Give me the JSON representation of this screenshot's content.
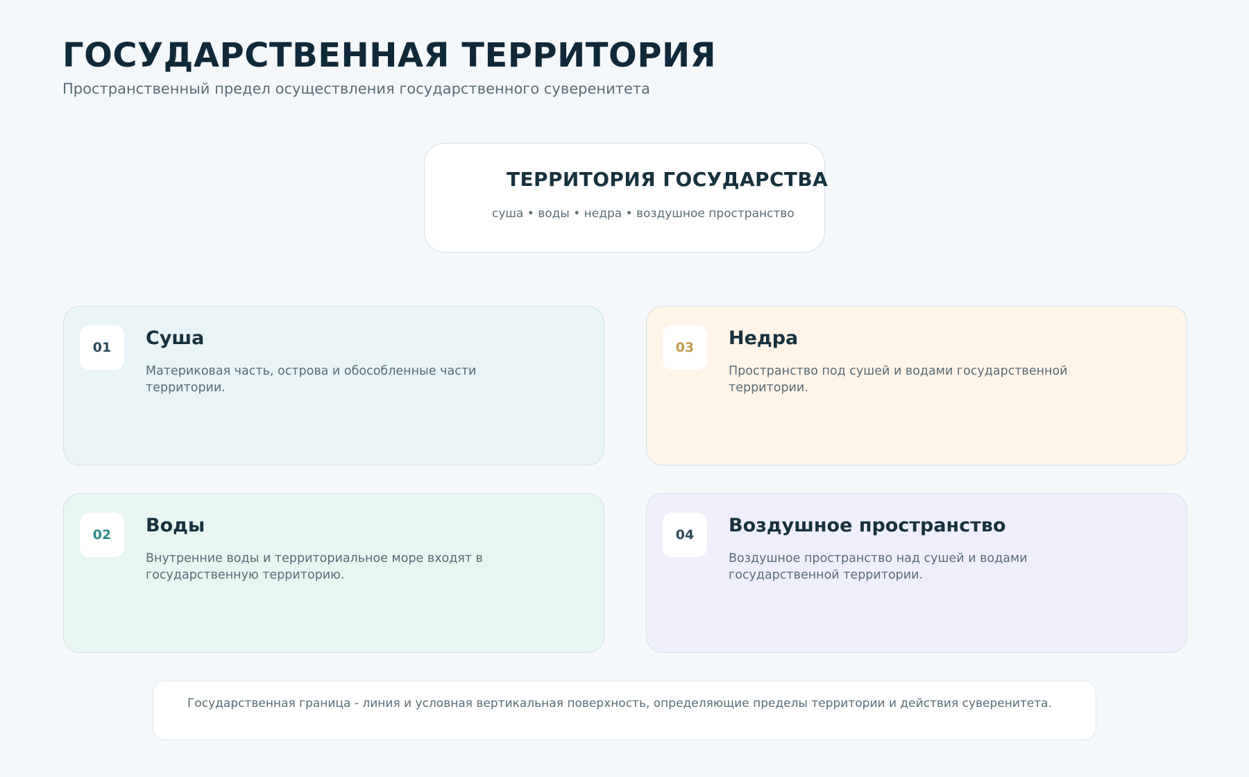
{
  "header": {
    "title": "ГОСУДАРСТВЕННАЯ ТЕРРИТОРИЯ",
    "subtitle": "Пространственный предел осуществления государственного суверенитета"
  },
  "center": {
    "title": "ТЕРРИТОРИЯ ГОСУДАРСТВА",
    "subtitle": "суша • воды • недра • воздушное пространство"
  },
  "cards": [
    {
      "number": "01",
      "title": "Суша",
      "text": "Материковая часть, острова и обособленные части территории.",
      "background": "#e8f4f6",
      "number_color": "#2d4a5c"
    },
    {
      "number": "02",
      "title": "Воды",
      "text": "Внутренние воды и территориальное море входят в государственную территорию.",
      "background": "#e7f6f1",
      "number_color": "#2e8b8b"
    },
    {
      "number": "03",
      "title": "Недра",
      "text": "Пространство под сушей и водами государственной территории.",
      "background": "#fff4e8",
      "number_color": "#c19a4a"
    },
    {
      "number": "04",
      "title": "Воздушное пространство",
      "text": "Воздушное пространство над сушей и водами государственной территории.",
      "background": "#efeffb",
      "number_color": "#2d4a5c"
    }
  ],
  "footer": {
    "text": "Государственная граница - линия и условная вертикальная поверхность, определяющие пределы территории и действия суверенитета."
  }
}
